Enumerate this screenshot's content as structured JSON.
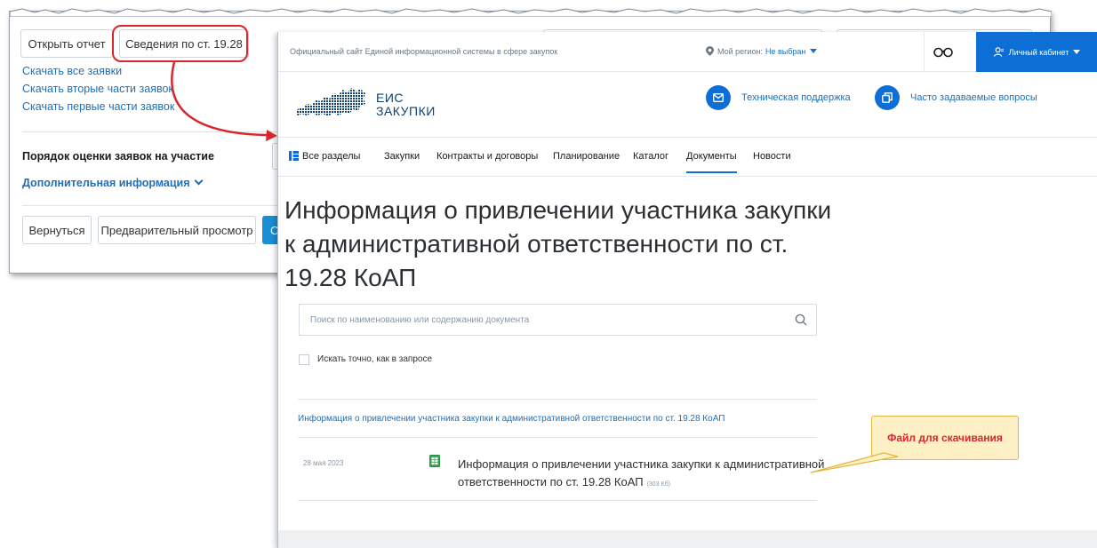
{
  "back_window": {
    "open_report_label": "Открыть отчет",
    "info_1928_label": "Сведения по ст. 19.28",
    "links": [
      "Скачать все заявки",
      "Скачать вторые части заявок",
      "Скачать первые части заявок"
    ],
    "evaluation_order_label": "Порядок оценки заявок на участие",
    "additional_info_label": "Дополнительная информация",
    "back_button_label": "Вернуться",
    "preview_button_label": "Предварительный просмотр",
    "partial_button_label": "С"
  },
  "eis": {
    "topbar": {
      "site_description": "Официальный сайт Единой информационной системы в сфере закупок",
      "region_label": "Мой регион:",
      "region_value": "Не выбран",
      "cabinet_label": "Личный кабинет"
    },
    "logo": {
      "line1": "ЕИС",
      "line2": "ЗАКУПКИ"
    },
    "support_label": "Техническая поддержка",
    "faq_label": "Часто задаваемые вопросы",
    "nav": {
      "all_sections": "Все разделы",
      "items": [
        "Закупки",
        "Контракты и договоры",
        "Планирование",
        "Каталог",
        "Документы",
        "Новости"
      ],
      "active": "Документы"
    },
    "page_title": "Информация о привлечении участника закупки к административной ответственности по ст. 19.28 КоАП",
    "search": {
      "placeholder": "Поиск по наименованию или содержанию документа",
      "exact_label": "Искать точно, как в запросе"
    },
    "section_link": "Информация о привлечении участника закупки к административной ответственности по ст. 19.28 КоАП",
    "document": {
      "date": "28 мая 2023",
      "title": "Информация о привлечении участника закупки к административной ответственности по ст. 19.28 КоАП",
      "size": "(303 Кб)"
    }
  },
  "callout_text": "Файл для скачивания",
  "colors": {
    "accent": "#0d6fd6",
    "link": "#1e6fb7",
    "annotation": "#d9262b",
    "callout_bg": "#fdf0c6"
  },
  "icons": [
    "map-pin-icon",
    "glasses-icon",
    "user-icon",
    "mail-icon",
    "copy-icon",
    "grid-menu-icon",
    "search-icon",
    "spreadsheet-file-icon",
    "chevron-down-icon"
  ]
}
